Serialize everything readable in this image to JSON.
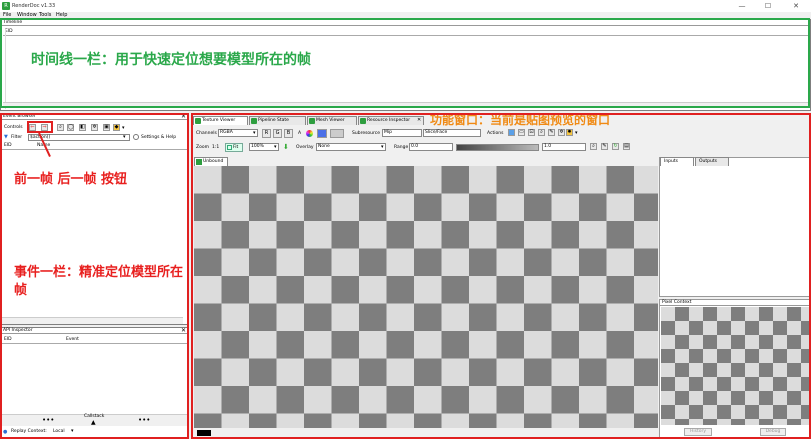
{
  "window": {
    "title": "RenderDoc v1.33",
    "min_glyph": "—",
    "max_glyph": "☐",
    "close_glyph": "✕"
  },
  "menu": [
    "File",
    "Window",
    "Tools",
    "Help"
  ],
  "timeline": {
    "title": "Timeline",
    "eid_header": "EID",
    "annotation": "时间线一栏：用于快速定位想要模型所在的帧"
  },
  "event_browser": {
    "title": "Event Browser",
    "controls_label": "Controls",
    "filter_label": "Filter",
    "filter_value": "$action()",
    "settings_label": "Settings & Help",
    "col_eid": "EID",
    "col_name": "Name",
    "annotation_nav": "前一帧 后一帧 按钮",
    "annotation_events": "事件一栏：精准定位模型所在帧"
  },
  "api_inspector": {
    "title": "API Inspector",
    "col_eid": "EID",
    "col_event": "Event",
    "callstack_label": "Callstack",
    "replay_context_label": "Replay Context:",
    "replay_context_value": "Local"
  },
  "tabs": [
    "Texture Viewer",
    "Pipeline State",
    "Mesh Viewer",
    "Resource Inspector"
  ],
  "feature_annotation": "功能窗口：当前是贴图预览的窗口",
  "texture_viewer": {
    "channels_label": "Channels",
    "channels_value": "RGBA",
    "r": "R",
    "g": "G",
    "b": "B",
    "a": "A",
    "subresource_label": "Subresource",
    "mip_value": "Mip",
    "slice_value": "Slice/Face",
    "actions_label": "Actions",
    "zoom_label": "Zoom",
    "zoom_ratio": "1:1",
    "fit_label": "Fit",
    "zoom_value": "100%",
    "overlay_label": "Overlay",
    "overlay_value": "None",
    "range_label": "Range",
    "range_min": "0.0",
    "range_max": "1.0",
    "unbound_tab": "Unbound",
    "inputs_tab": "Inputs",
    "outputs_tab": "Outputs",
    "pixel_context_title": "Pixel Context",
    "history_button": "History",
    "debug_button": "Debug"
  }
}
